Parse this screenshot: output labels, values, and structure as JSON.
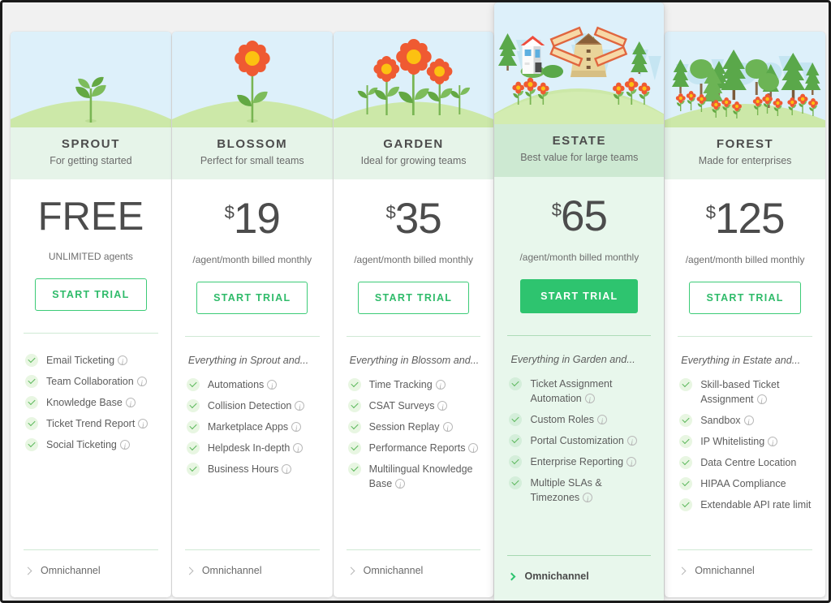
{
  "page": {
    "background_color": "#f1f1f1",
    "accent_color": "#2ec46f",
    "header_band_color": "#e6f4e9",
    "featured_band_color": "#cde9d2",
    "sky_color": "#ddf0fa",
    "hill_color": "#cce8a8"
  },
  "plans": [
    {
      "id": "sprout",
      "illustration": "sprout-illustration",
      "name": "SPROUT",
      "tagline": "For getting started",
      "currency": "",
      "amount": "FREE",
      "billing": "UNLIMITED agents",
      "cta": "START TRIAL",
      "featured": false,
      "inherits": "",
      "features": [
        {
          "label": "Email Ticketing",
          "info": true
        },
        {
          "label": "Team Collaboration",
          "info": true
        },
        {
          "label": "Knowledge Base",
          "info": true
        },
        {
          "label": "Ticket Trend Report",
          "info": true
        },
        {
          "label": "Social Ticketing",
          "info": true
        }
      ],
      "footer_item": "Omnichannel"
    },
    {
      "id": "blossom",
      "illustration": "flower-illustration",
      "name": "BLOSSOM",
      "tagline": "Perfect for small teams",
      "currency": "$",
      "amount": "19",
      "billing": "/agent/month billed monthly",
      "cta": "START TRIAL",
      "featured": false,
      "inherits": "Everything in Sprout and...",
      "features": [
        {
          "label": "Automations",
          "info": true
        },
        {
          "label": "Collision Detection",
          "info": true
        },
        {
          "label": "Marketplace Apps",
          "info": true
        },
        {
          "label": "Helpdesk In-depth",
          "info": true
        },
        {
          "label": "Business Hours",
          "info": true
        }
      ],
      "footer_item": "Omnichannel"
    },
    {
      "id": "garden",
      "illustration": "garden-illustration",
      "name": "GARDEN",
      "tagline": "Ideal for growing teams",
      "currency": "$",
      "amount": "35",
      "billing": "/agent/month billed monthly",
      "cta": "START TRIAL",
      "featured": false,
      "inherits": "Everything in Blossom and...",
      "features": [
        {
          "label": "Time Tracking",
          "info": true
        },
        {
          "label": "CSAT Surveys",
          "info": true
        },
        {
          "label": "Session Replay",
          "info": true
        },
        {
          "label": "Performance Reports",
          "info": true
        },
        {
          "label": "Multilingual Knowledge Base",
          "info": true
        }
      ],
      "footer_item": "Omnichannel"
    },
    {
      "id": "estate",
      "illustration": "estate-illustration",
      "name": "ESTATE",
      "tagline": "Best value for large teams",
      "currency": "$",
      "amount": "65",
      "billing": "/agent/month billed monthly",
      "cta": "START TRIAL",
      "featured": true,
      "inherits": "Everything in Garden and...",
      "features": [
        {
          "label": "Ticket Assignment Automation",
          "info": true
        },
        {
          "label": "Custom Roles",
          "info": true
        },
        {
          "label": "Portal Customization",
          "info": true
        },
        {
          "label": "Enterprise Reporting",
          "info": true
        },
        {
          "label": "Multiple SLAs & Timezones",
          "info": true
        }
      ],
      "footer_item": "Omnichannel"
    },
    {
      "id": "forest",
      "illustration": "forest-illustration",
      "name": "FOREST",
      "tagline": "Made for enterprises",
      "currency": "$",
      "amount": "125",
      "billing": "/agent/month billed monthly",
      "cta": "START TRIAL",
      "featured": false,
      "inherits": "Everything in Estate and...",
      "features": [
        {
          "label": "Skill-based Ticket Assignment",
          "info": true
        },
        {
          "label": "Sandbox",
          "info": true
        },
        {
          "label": "IP Whitelisting",
          "info": true
        },
        {
          "label": "Data Centre Location",
          "info": false
        },
        {
          "label": "HIPAA Compliance",
          "info": false
        },
        {
          "label": "Extendable API rate limit",
          "info": false
        }
      ],
      "footer_item": "Omnichannel"
    }
  ]
}
